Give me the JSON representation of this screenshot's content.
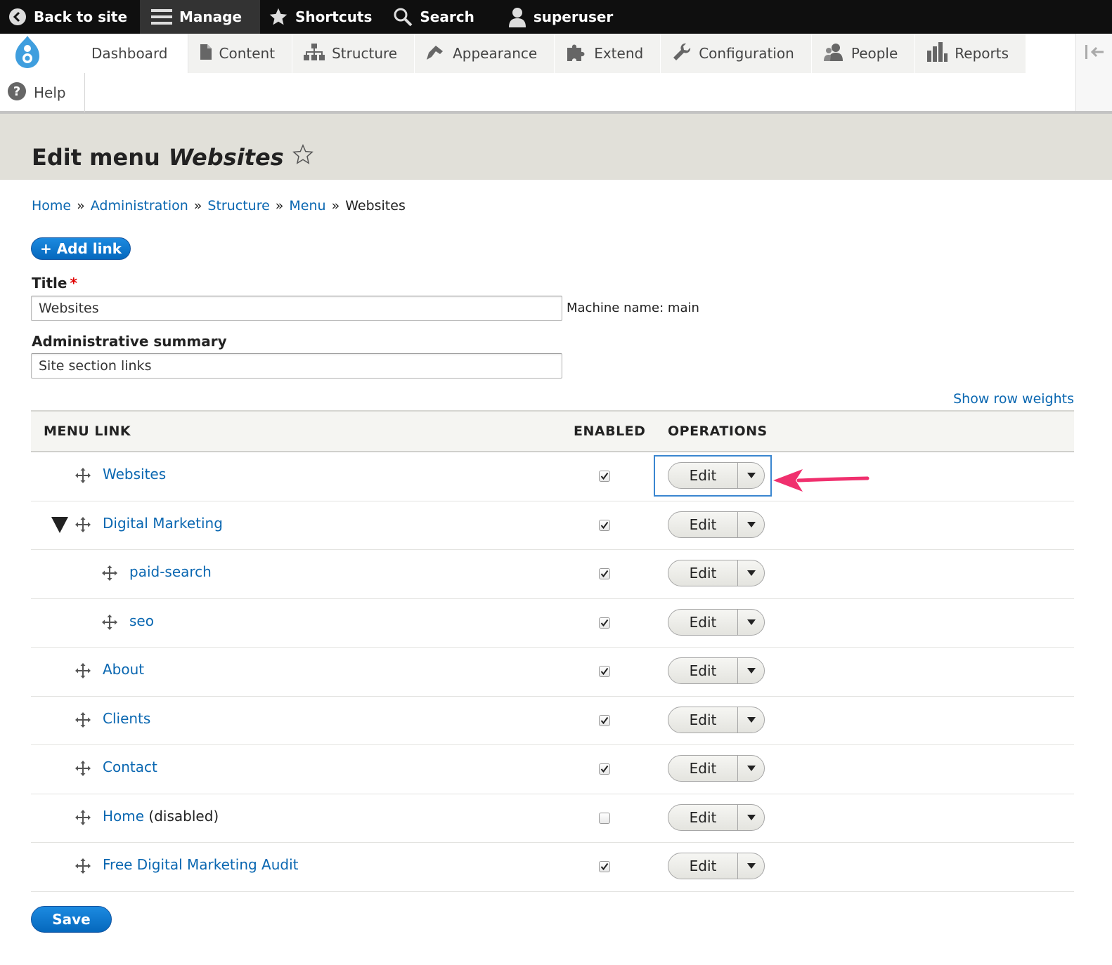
{
  "toolbar": {
    "back_to_site": "Back to site",
    "manage": "Manage",
    "shortcuts": "Shortcuts",
    "search": "Search",
    "user": "superuser"
  },
  "admin_menu": {
    "items": [
      {
        "label": "Dashboard",
        "icon": "none"
      },
      {
        "label": "Content",
        "icon": "page-icon"
      },
      {
        "label": "Structure",
        "icon": "sitemap-icon"
      },
      {
        "label": "Appearance",
        "icon": "paintbrush-icon"
      },
      {
        "label": "Extend",
        "icon": "puzzle-icon"
      },
      {
        "label": "Configuration",
        "icon": "wrench-icon"
      },
      {
        "label": "People",
        "icon": "people-icon"
      },
      {
        "label": "Reports",
        "icon": "bar-chart-icon"
      }
    ],
    "help": "Help"
  },
  "page": {
    "title_prefix": "Edit menu",
    "title_name": "Websites"
  },
  "breadcrumb": {
    "items": [
      "Home",
      "Administration",
      "Structure",
      "Menu"
    ],
    "current": "Websites",
    "separator": "»"
  },
  "add_link": "+ Add link",
  "form": {
    "title_label": "Title",
    "required_mark": "*",
    "title_value": "Websites",
    "machine_name": "Machine name: main",
    "summary_label": "Administrative summary",
    "summary_value": "Site section links"
  },
  "show_row_weights": "Show row weights",
  "table": {
    "headers": {
      "menu_link": "MENU LINK",
      "enabled": "ENABLED",
      "operations": "OPERATIONS"
    },
    "edit_label": "Edit",
    "rows": [
      {
        "name": "Websites",
        "suffix": "",
        "indent": 0,
        "enabled": true,
        "expanded": false
      },
      {
        "name": "Digital Marketing",
        "suffix": "",
        "indent": 0,
        "enabled": true,
        "expanded": true
      },
      {
        "name": "paid-search",
        "suffix": "",
        "indent": 1,
        "enabled": true,
        "expanded": false
      },
      {
        "name": "seo",
        "suffix": "",
        "indent": 1,
        "enabled": true,
        "expanded": false
      },
      {
        "name": "About",
        "suffix": "",
        "indent": 0,
        "enabled": true,
        "expanded": false
      },
      {
        "name": "Clients",
        "suffix": "",
        "indent": 0,
        "enabled": true,
        "expanded": false
      },
      {
        "name": "Contact",
        "suffix": "",
        "indent": 0,
        "enabled": true,
        "expanded": false
      },
      {
        "name": "Home",
        "suffix": "(disabled)",
        "indent": 0,
        "enabled": false,
        "expanded": false
      },
      {
        "name": "Free Digital Marketing Audit",
        "suffix": "",
        "indent": 0,
        "enabled": true,
        "expanded": false
      }
    ]
  },
  "save": "Save",
  "colors": {
    "link": "#0a67b1",
    "primary": "#0568bd",
    "annotation_arrow": "#f0306e",
    "focus_box": "#3a86d0"
  }
}
